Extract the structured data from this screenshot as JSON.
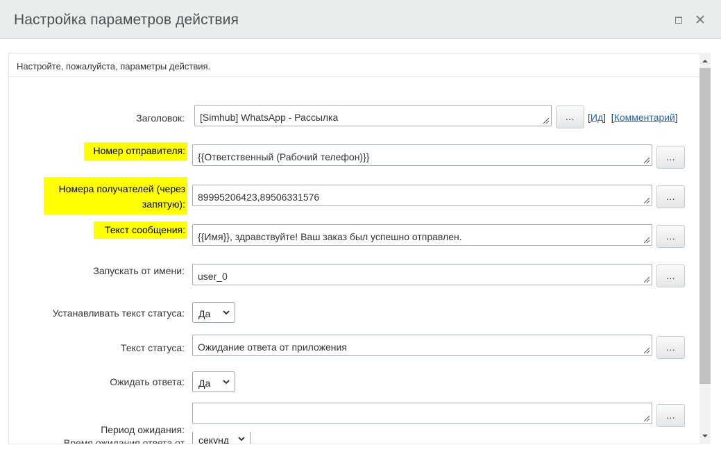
{
  "window": {
    "title": "Настройка параметров действия",
    "maximize_icon": "maximize-icon",
    "close_icon": "close-icon"
  },
  "intro_text": "Настройте, пожалуйста, параметры действия.",
  "colors": {
    "highlight": "#ffff00",
    "link": "#2067b0",
    "titlebar": "#e9edee"
  },
  "links": {
    "id_label": "Ид",
    "comment_label": "Комментарий"
  },
  "fields": {
    "title": {
      "label": "Заголовок:",
      "value": "[Simhub] WhatsApp - Рассылка",
      "button": "..."
    },
    "sender": {
      "label": "Номер отправителя:",
      "value": "{{Ответственный (Рабочий телефон)}}",
      "button": "..."
    },
    "recipients": {
      "label_line1": "Номера получателей (через",
      "label_line2": "запятую):",
      "value": "89995206423,89506331576",
      "button": "..."
    },
    "message": {
      "label": "Текст сообщения:",
      "value": "{{Имя}}, здравствуйте! Ваш заказ был успешно отправлен.",
      "button": "..."
    },
    "run_as": {
      "label": "Запускать от имени:",
      "value": "user_0",
      "button": "..."
    },
    "set_status": {
      "label": "Устанавливать текст статуса:",
      "value": "Да"
    },
    "status_text": {
      "label": "Текст статуса:",
      "value": "Ожидание ответа от приложения",
      "button": "..."
    },
    "wait_reply": {
      "label": "Ожидать ответа:",
      "value": "Да"
    },
    "wait_period": {
      "label": "Период ожидания:",
      "value": "",
      "button": "..."
    },
    "wait_time": {
      "label": "Время ожидания ответа от",
      "value": "секунд"
    }
  }
}
